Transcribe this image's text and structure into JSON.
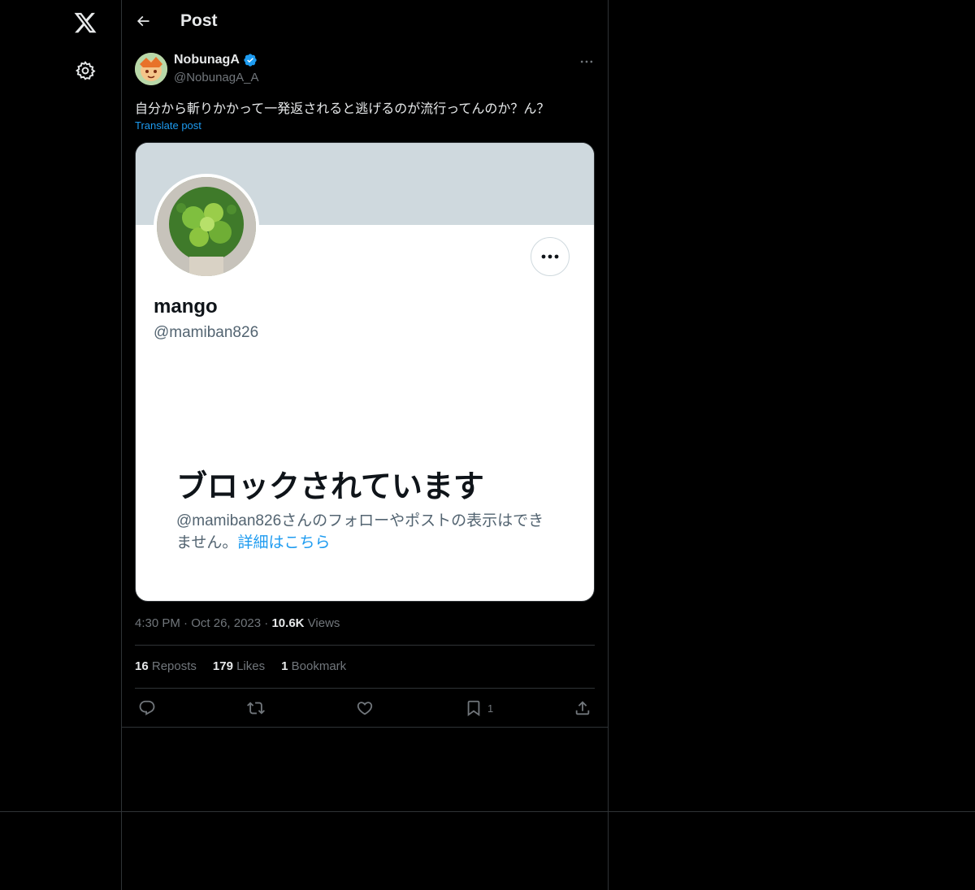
{
  "header": {
    "title": "Post"
  },
  "post": {
    "author_name": "NobunagA",
    "author_handle": "@NobunagA_A",
    "text": "自分から斬りかかって一発返されると逃げるのが流行ってんのか？ん？",
    "translate_label": "Translate post",
    "time": "4:30 PM",
    "date": "Oct 26, 2023",
    "views_count": "10.6K",
    "views_label": "Views",
    "reposts_count": "16",
    "reposts_label": "Reposts",
    "likes_count": "179",
    "likes_label": "Likes",
    "bookmarks_count": "1",
    "bookmarks_label": "Bookmark",
    "bookmark_action_count": "1"
  },
  "media": {
    "profile_name": "mango",
    "profile_handle": "@mamiban826",
    "blocked_title": "ブロックされています",
    "blocked_body": "@mamiban826さんのフォローやポストの表示はできません。",
    "blocked_link": "詳細はこちら"
  },
  "colors": {
    "accent": "#1d9bf0",
    "background": "#000000",
    "border": "#2f3336",
    "muted_text": "#71767b"
  },
  "icons": [
    "x-logo-icon",
    "gear-icon",
    "back-arrow-icon",
    "verified-badge-icon",
    "more-icon",
    "reply-icon",
    "repost-icon",
    "like-icon",
    "bookmark-icon",
    "share-icon"
  ]
}
